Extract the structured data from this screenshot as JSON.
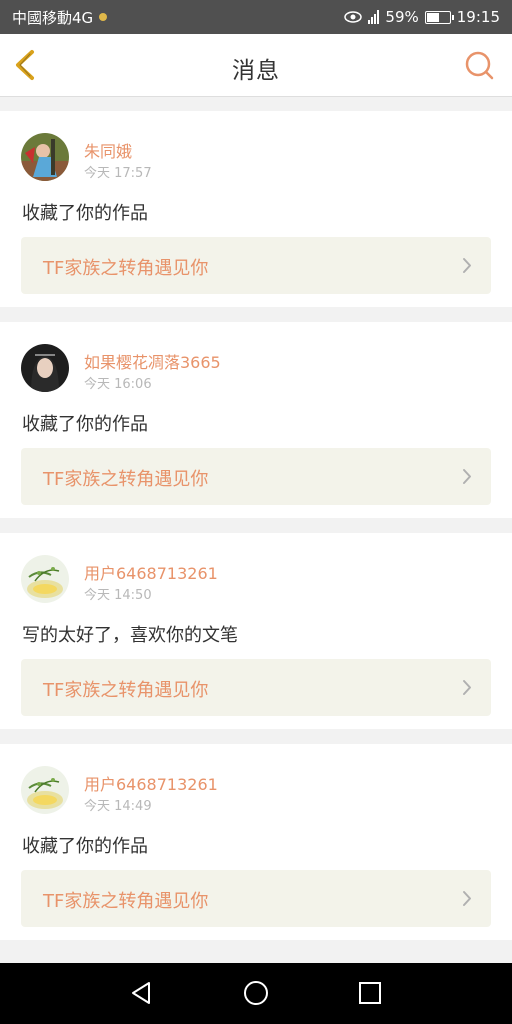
{
  "status_bar": {
    "carrier": "中國移動4G",
    "battery": "59%",
    "battery_level": 0.59,
    "time": "19:15"
  },
  "header": {
    "title": "消息",
    "back_icon": "chevron-left-icon",
    "search_icon": "search-icon"
  },
  "messages": [
    {
      "user": "朱同娥",
      "time": "今天 17:57",
      "text": "收藏了你的作品",
      "work": "TF家族之转角遇见你"
    },
    {
      "user": "如果樱花凋落3665",
      "time": "今天 16:06",
      "text": "收藏了你的作品",
      "work": "TF家族之转角遇见你"
    },
    {
      "user": "用户6468713261",
      "time": "今天 14:50",
      "text": "写的太好了，喜欢你的文笔",
      "work": "TF家族之转角遇见你"
    },
    {
      "user": "用户6468713261",
      "time": "今天 14:49",
      "text": "收藏了你的作品",
      "work": "TF家族之转角遇见你"
    }
  ],
  "colors": {
    "accent": "#e8936a",
    "back_icon": "#d9a21c",
    "header_bg": "#ffffff",
    "work_bg": "#f3f3ea"
  }
}
